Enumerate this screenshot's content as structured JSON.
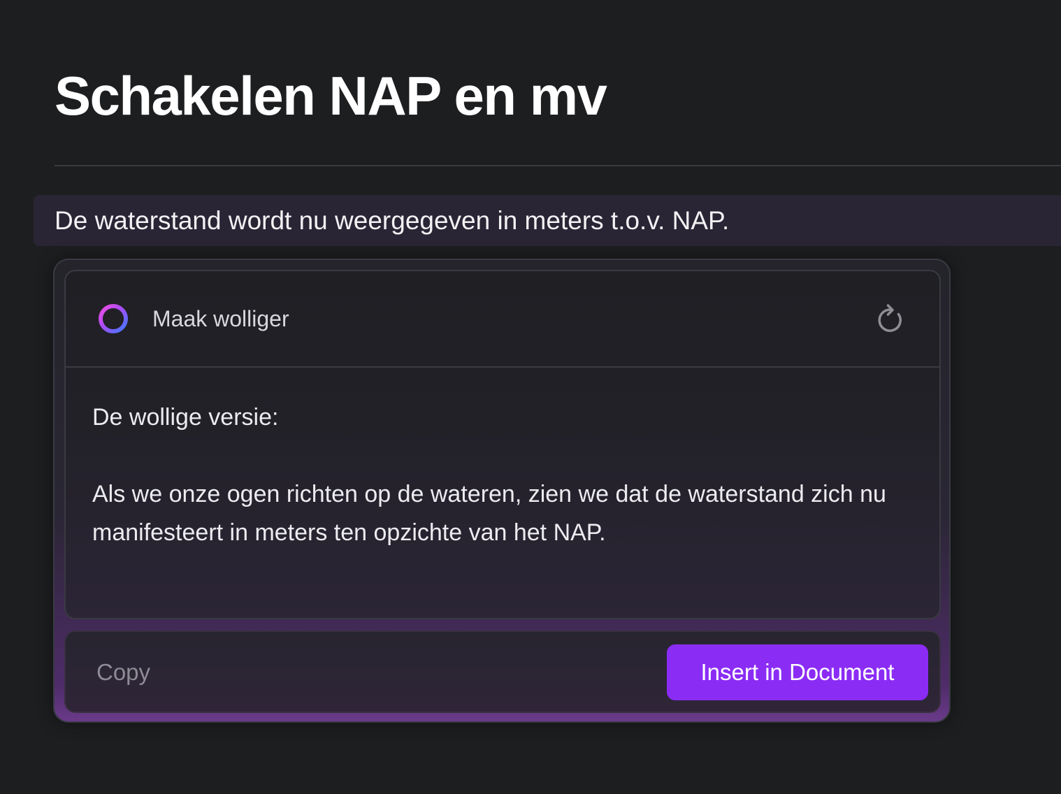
{
  "document": {
    "title": "Schakelen NAP en mv",
    "selected_text": "De waterstand wordt nu weergegeven in meters t.o.v. NAP."
  },
  "ai_panel": {
    "prompt_label": "Maak wolliger",
    "prompt_icon": "ai-ring-icon",
    "regenerate_icon": "refresh-icon",
    "result_intro": "De wollige versie:",
    "result_text": "Als we onze ogen richten op de wateren, zien we dat de waterstand zich nu manifesteert in meters ten opzichte van het NAP.",
    "copy_label": "Copy",
    "insert_label": "Insert in Document"
  },
  "colors": {
    "background": "#1d1e20",
    "selection": "#2a2535",
    "accent": "#8b2cf5"
  }
}
